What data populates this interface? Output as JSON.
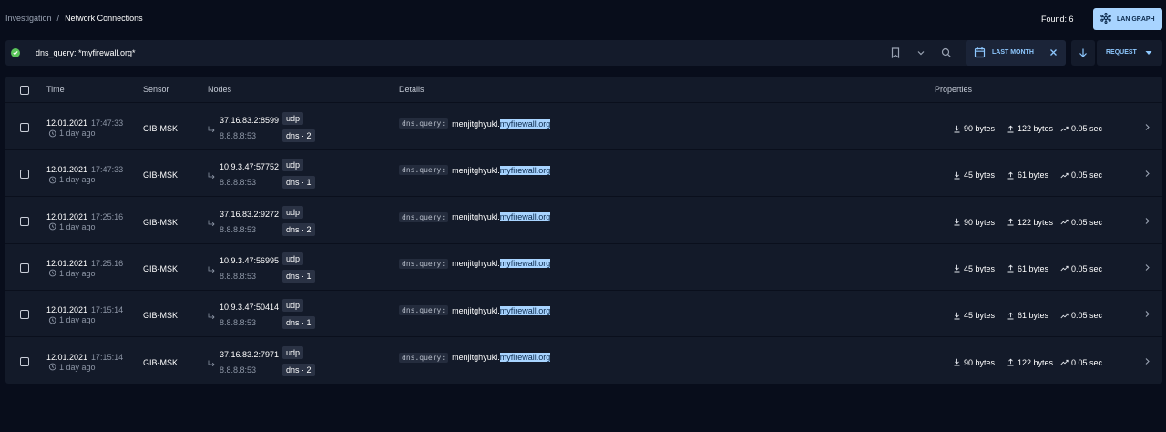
{
  "breadcrumb": {
    "parent": "Investigation",
    "separator": "/",
    "current": "Network Connections"
  },
  "found": "Found: 6",
  "lan_graph_label": "LAN GRAPH",
  "search": {
    "query": "dns_query: *myfirewall.org*",
    "date_range": "LAST MONTH",
    "sort_label": "REQUEST"
  },
  "table": {
    "headers": {
      "time": "Time",
      "sensor": "Sensor",
      "nodes": "Nodes",
      "details": "Details",
      "properties": "Properties"
    },
    "rows": [
      {
        "date": "12.01.2021",
        "time": "17:47:33",
        "ago": "1 day ago",
        "sensor": "GIB-MSK",
        "src": "37.16.83.2:8599",
        "protocol": "udp",
        "dst": "8.8.8.8:53",
        "service": "dns · 2",
        "field": "dns.query:",
        "prefix": "menjitghyukl.",
        "match": "myfirewall.org",
        "down": "90 bytes",
        "up": "122 bytes",
        "duration": "0.05 sec"
      },
      {
        "date": "12.01.2021",
        "time": "17:47:33",
        "ago": "1 day ago",
        "sensor": "GIB-MSK",
        "src": "10.9.3.47:57752",
        "protocol": "udp",
        "dst": "8.8.8.8:53",
        "service": "dns · 1",
        "field": "dns.query:",
        "prefix": "menjitghyukl.",
        "match": "myfirewall.org",
        "down": "45 bytes",
        "up": "61 bytes",
        "duration": "0.05 sec"
      },
      {
        "date": "12.01.2021",
        "time": "17:25:16",
        "ago": "1 day ago",
        "sensor": "GIB-MSK",
        "src": "37.16.83.2:9272",
        "protocol": "udp",
        "dst": "8.8.8.8:53",
        "service": "dns · 2",
        "field": "dns.query:",
        "prefix": "menjitghyukl.",
        "match": "myfirewall.org",
        "down": "90 bytes",
        "up": "122 bytes",
        "duration": "0.05 sec"
      },
      {
        "date": "12.01.2021",
        "time": "17:25:16",
        "ago": "1 day ago",
        "sensor": "GIB-MSK",
        "src": "10.9.3.47:56995",
        "protocol": "udp",
        "dst": "8.8.8.8:53",
        "service": "dns · 1",
        "field": "dns.query:",
        "prefix": "menjitghyukl.",
        "match": "myfirewall.org",
        "down": "45 bytes",
        "up": "61 bytes",
        "duration": "0.05 sec"
      },
      {
        "date": "12.01.2021",
        "time": "17:15:14",
        "ago": "1 day ago",
        "sensor": "GIB-MSK",
        "src": "10.9.3.47:50414",
        "protocol": "udp",
        "dst": "8.8.8.8:53",
        "service": "dns · 1",
        "field": "dns.query:",
        "prefix": "menjitghyukl.",
        "match": "myfirewall.org",
        "down": "45 bytes",
        "up": "61 bytes",
        "duration": "0.05 sec"
      },
      {
        "date": "12.01.2021",
        "time": "17:15:14",
        "ago": "1 day ago",
        "sensor": "GIB-MSK",
        "src": "37.16.83.2:7971",
        "protocol": "udp",
        "dst": "8.8.8.8:53",
        "service": "dns · 2",
        "field": "dns.query:",
        "prefix": "menjitghyukl.",
        "match": "myfirewall.org",
        "down": "90 bytes",
        "up": "122 bytes",
        "duration": "0.05 sec"
      }
    ]
  },
  "colors": {
    "background": "#080d1b",
    "panel": "#131a29",
    "accent": "#a8d4ff",
    "success": "#5ac45a"
  }
}
